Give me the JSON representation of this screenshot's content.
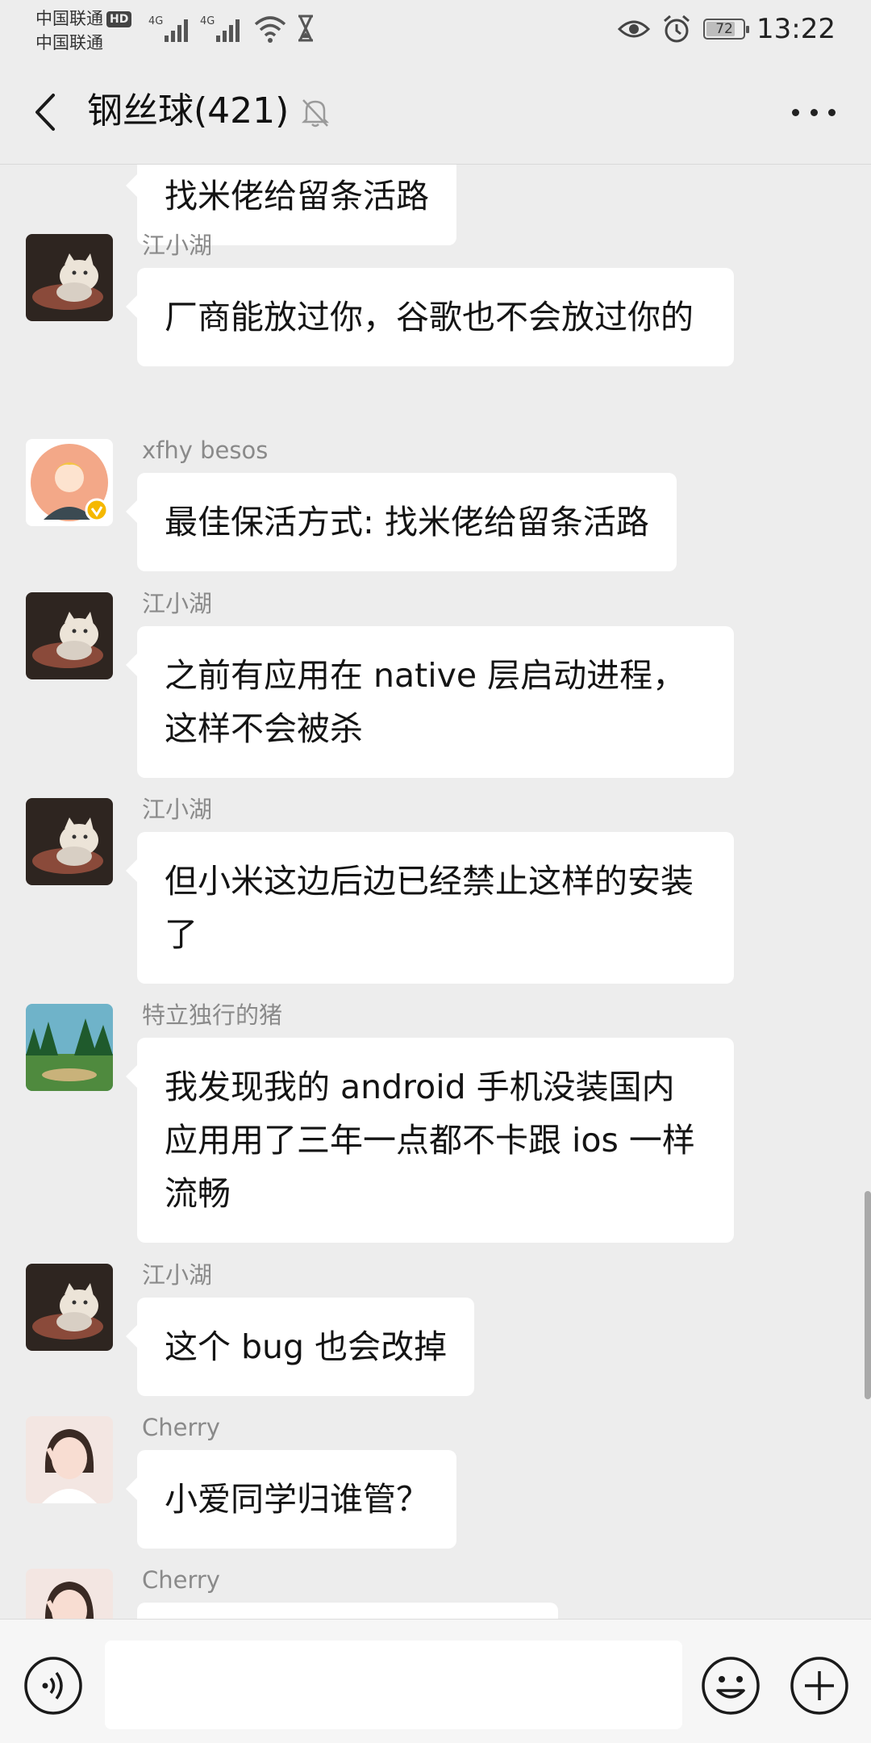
{
  "status_bar": {
    "carrier_1": "中国联通",
    "carrier_1_badge": "HD",
    "carrier_2": "中国联通",
    "network_1": "4G",
    "network_2": "4G",
    "battery_level": "72",
    "time": "13:22"
  },
  "header": {
    "title": "钢丝球(421)"
  },
  "messages": [
    {
      "sender": "",
      "text": "找米佬给留条活路",
      "avatar": "partial-avatar"
    },
    {
      "sender": "江小湖",
      "text": "厂商能放过你，谷歌也不会放过你的",
      "avatar": "cat-avatar"
    },
    {
      "sender": "xfhy besos",
      "text": "最佳保活方式: 找米佬给留条活路",
      "avatar": "cartoon-avatar"
    },
    {
      "sender": "江小湖",
      "text": "之前有应用在 native 层启动进程，这样不会被杀",
      "avatar": "cat-avatar"
    },
    {
      "sender": "江小湖",
      "text": "但小米这边后边已经禁止这样的安装了",
      "avatar": "cat-avatar"
    },
    {
      "sender": "特立独行的猪",
      "text": "我发现我的 android 手机没装国内应用用了三年一点都不卡跟 ios 一样流畅",
      "avatar": "landscape-avatar"
    },
    {
      "sender": "江小湖",
      "text": "这个 bug 也会改掉",
      "avatar": "cat-avatar"
    },
    {
      "sender": "Cherry",
      "text": "小爱同学归谁管？",
      "avatar": "girl-avatar"
    },
    {
      "sender": "Cherry",
      "text": "",
      "avatar": "girl-avatar"
    }
  ],
  "input": {
    "value": ""
  },
  "colors": {
    "background": "#ededed",
    "bubble": "#ffffff",
    "sender_text": "#8a8a8a",
    "verified_badge": "#f5b800"
  }
}
